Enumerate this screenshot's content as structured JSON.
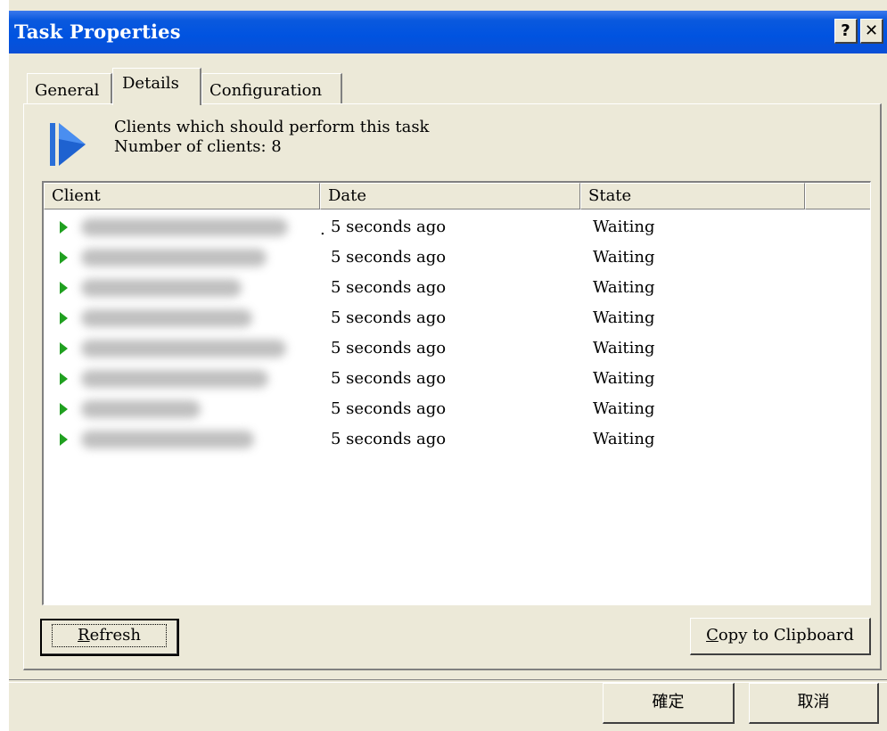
{
  "window": {
    "title": "Task Properties",
    "help_label": "?",
    "close_label": "✕"
  },
  "tabs": [
    {
      "label": "General",
      "active": false
    },
    {
      "label": "Details",
      "active": true
    },
    {
      "label": "Configuration",
      "active": false
    }
  ],
  "details": {
    "icon": "task-play-icon",
    "description": "Clients which should perform this task",
    "count_text": "Number of clients: 8"
  },
  "list": {
    "columns": [
      "Client",
      "Date",
      "State"
    ],
    "rows": [
      {
        "client": "",
        "date": "5 seconds ago",
        "state": "Waiting"
      },
      {
        "client": "",
        "date": "5 seconds ago",
        "state": "Waiting"
      },
      {
        "client": "",
        "date": "5 seconds ago",
        "state": "Waiting"
      },
      {
        "client": "",
        "date": "5 seconds ago",
        "state": "Waiting"
      },
      {
        "client": "",
        "date": "5 seconds ago",
        "state": "Waiting"
      },
      {
        "client": "",
        "date": "5 seconds ago",
        "state": "Waiting"
      },
      {
        "client": "",
        "date": "5 seconds ago",
        "state": "Waiting"
      },
      {
        "client": "",
        "date": "5 seconds ago",
        "state": "Waiting"
      }
    ]
  },
  "buttons": {
    "refresh_hotkey": "R",
    "refresh_rest": "efresh",
    "copy_hotkey": "C",
    "copy_rest": "opy to Clipboard",
    "ok": "確定",
    "cancel": "取消"
  },
  "colors": {
    "titlebar": "#0053e0",
    "face": "#ece9d8",
    "arrow": "#20a020",
    "icon": "#1e62d0"
  }
}
